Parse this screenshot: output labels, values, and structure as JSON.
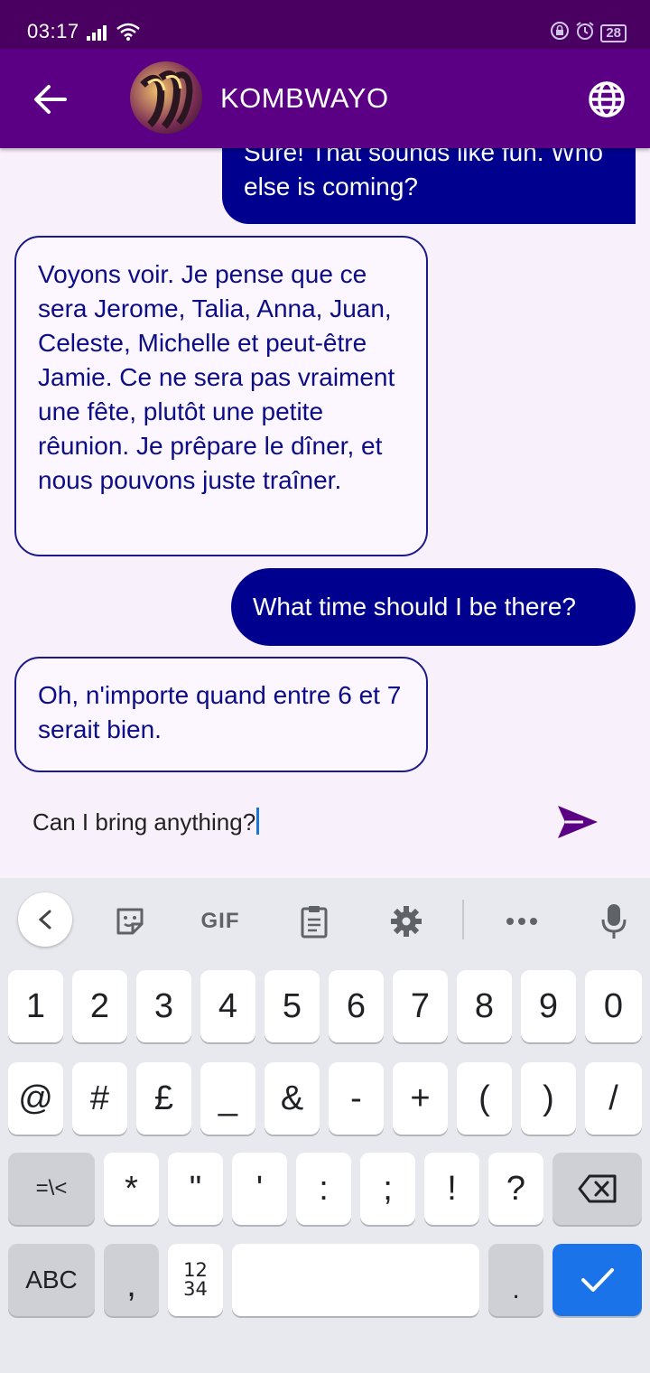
{
  "status_bar": {
    "time": "03:17",
    "battery": "28"
  },
  "header": {
    "title": "KOMBWAYO"
  },
  "messages": [
    {
      "direction": "outgoing",
      "text": "Sure! That sounds like fun. Who else is coming?"
    },
    {
      "direction": "incoming",
      "text": "Voyons voir. Je pense que ce sera Jerome, Talia, Anna, Juan, Celeste, Michelle et peut-être Jamie. Ce ne sera pas vraiment une fête, plutôt une petite rêunion. Je prêpare le dîner, et nous pouvons juste traîner."
    },
    {
      "direction": "outgoing",
      "text": "What time should I be there?"
    },
    {
      "direction": "incoming",
      "text": "Oh, n'importe quand entre 6 et 7 serait bien."
    }
  ],
  "composer": {
    "value": "Can I bring anything?"
  },
  "keyboard": {
    "toolbar": {
      "gif_label": "GIF"
    },
    "row1": [
      "1",
      "2",
      "3",
      "4",
      "5",
      "6",
      "7",
      "8",
      "9",
      "0"
    ],
    "row2": [
      "@",
      "#",
      "£",
      "_",
      "&",
      "-",
      "+",
      "(",
      ")",
      "/"
    ],
    "row3": {
      "shift_label": "=\\<",
      "keys": [
        "*",
        "\"",
        "'",
        ":",
        ";",
        "!",
        "?"
      ]
    },
    "row4": {
      "abc_label": "ABC",
      "comma": ",",
      "numpad_label_top": "12",
      "numpad_label_bottom": "34",
      "period": "."
    }
  },
  "colors": {
    "appbar": "#5b0085",
    "statusbar": "#4a0060",
    "outgoing_bubble": "#00008f",
    "incoming_text": "#0b0c86",
    "accent": "#1a73e8"
  }
}
